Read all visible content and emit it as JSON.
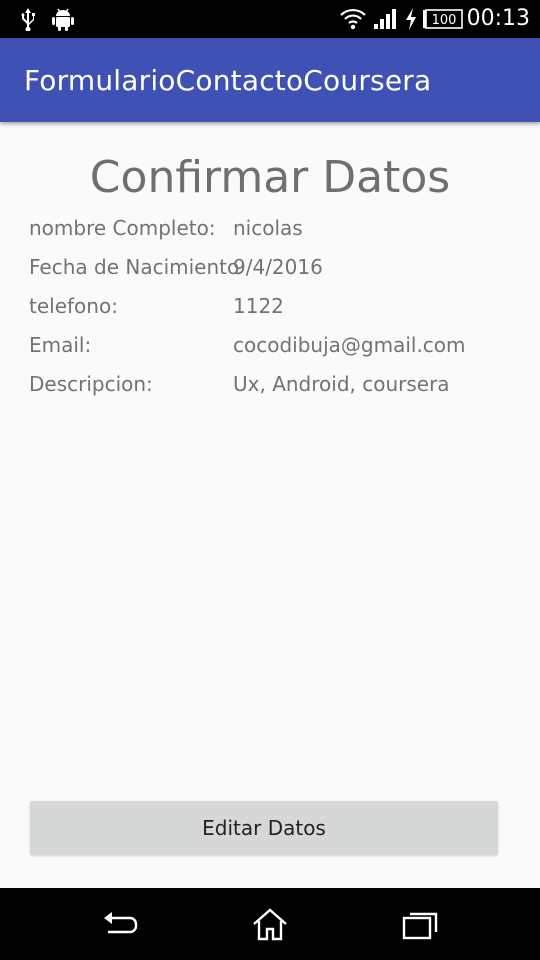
{
  "status_bar": {
    "time": "00:13",
    "battery": "100",
    "icons": [
      "usb-icon",
      "android-icon",
      "wifi-icon",
      "signal-icon",
      "charging-icon",
      "battery-icon"
    ]
  },
  "app_bar": {
    "title": "FormularioContactoCoursera",
    "color": "#3f51b5"
  },
  "main": {
    "heading": "Confirmar Datos",
    "fields": [
      {
        "label": "nombre Completo:",
        "value": "nicolas"
      },
      {
        "label": "Fecha de Nacimiento",
        "value": "9/4/2016"
      },
      {
        "label": "telefono:",
        "value": "1122"
      },
      {
        "label": "Email:",
        "value": "cocodibuja@gmail.com"
      },
      {
        "label": "Descripcion:",
        "value": "Ux, Android, coursera"
      }
    ],
    "edit_button_label": "Editar Datos"
  },
  "nav_bar": {
    "buttons": [
      "back-icon",
      "home-icon",
      "recents-icon"
    ]
  }
}
